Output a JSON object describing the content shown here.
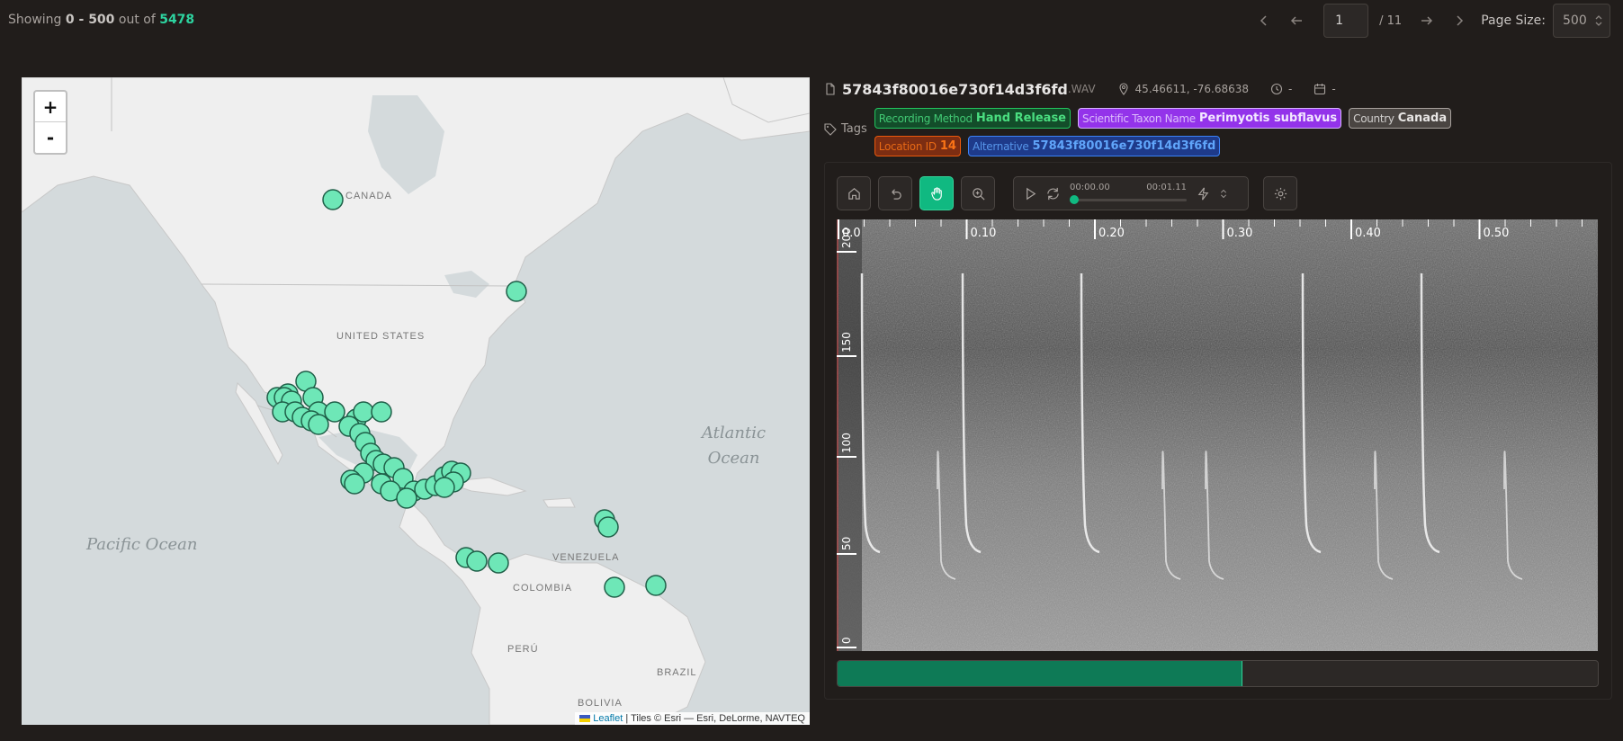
{
  "pagination": {
    "showing_prefix": "Showing",
    "range": "0 - 500",
    "out_of": "out of",
    "total": "5478",
    "current_page": "1",
    "page_count": "/ 11",
    "page_size_label": "Page Size:",
    "page_size": "500"
  },
  "map": {
    "zoom_in": "+",
    "zoom_out": "-",
    "labels": {
      "canada": "CANADA",
      "united_states": "UNITED STATES",
      "venezuela": "VENEZUELA",
      "colombia": "COLOMBIA",
      "peru": "PERÚ",
      "brazil": "BRAZIL",
      "bolivia": "BOLIVIA"
    },
    "oceans": {
      "pacific": "Pacific Ocean",
      "atlantic_1": "Atlantic",
      "atlantic_2": "Ocean"
    },
    "attribution_link": "Leaflet",
    "attribution_text": "| Tiles © Esri — Esri, DeLorme, NAVTEQ",
    "marker_color": "#6ee7b7"
  },
  "recording": {
    "filename": "57843f80016e730f14d3f6fd",
    "extension": ".WAV",
    "coordinates": "45.46611, -76.68638",
    "time": "-",
    "date": "-"
  },
  "tags": {
    "label": "Tags",
    "items": [
      {
        "key": "Recording Method",
        "value": "Hand Release",
        "color": "green"
      },
      {
        "key": "Scientific Taxon Name",
        "value": "Perimyotis subflavus",
        "color": "purple"
      },
      {
        "key": "Country",
        "value": "Canada",
        "color": "gray"
      },
      {
        "key": "Location ID",
        "value": "14",
        "color": "orange"
      },
      {
        "key": "Alternative",
        "value": "57843f80016e730f14d3f6fd",
        "color": "blue"
      }
    ]
  },
  "player": {
    "current_time": "00:00.00",
    "duration": "00:01.11",
    "progress": 0
  },
  "spectrogram": {
    "x_ticks": [
      "0.0",
      "0.10",
      "0.20",
      "0.30",
      "0.40",
      "0.50"
    ],
    "y_ticks": [
      "200",
      "150",
      "100",
      "50",
      "0"
    ]
  },
  "load_progress": 0.533
}
